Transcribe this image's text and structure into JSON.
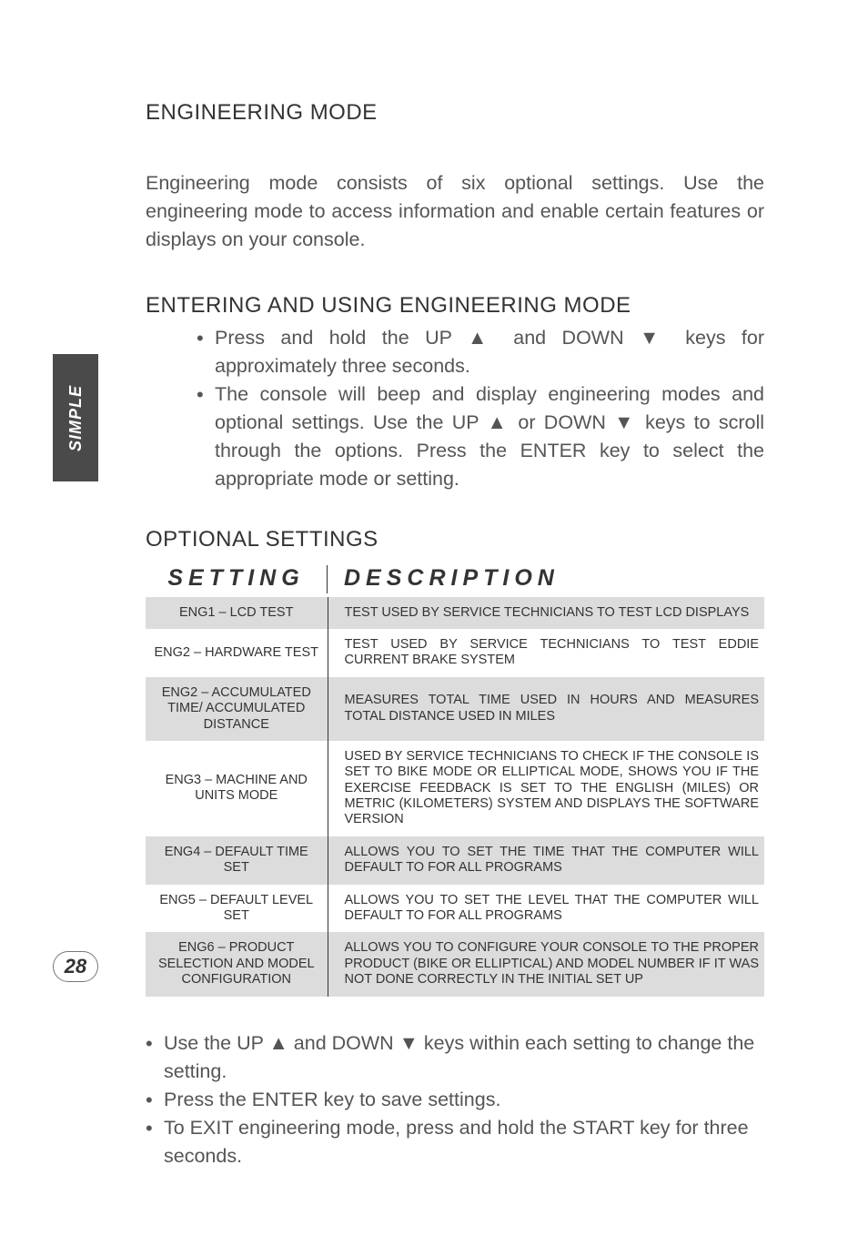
{
  "side_tab": "SIMPLE",
  "page_number": "28",
  "heading_engineering_mode": "ENGINEERING MODE",
  "para_engineering_mode": "Engineering mode consists of six optional settings. Use the engineering mode to access information and enable certain features or displays on your console.",
  "heading_entering": "ENTERING AND USING ENGINEERING MODE",
  "bullets_entering": [
    "Press and hold the UP ▲ and DOWN ▼ keys for approximately three seconds.",
    "The console will beep and display engineering modes and optional settings. Use the UP ▲ or DOWN ▼ keys to scroll through the options. Press the ENTER key to select the appropriate mode or setting."
  ],
  "heading_optional": "OPTIONAL SETTINGS",
  "table_header": {
    "setting": "SETTING",
    "description": "DESCRIPTION"
  },
  "rows": [
    {
      "setting": "ENG1 – LCD TEST",
      "desc": "TEST USED BY SERVICE TECHNICIANS TO TEST LCD DISPLAYS"
    },
    {
      "setting": "ENG2 – HARDWARE TEST",
      "desc": "TEST USED BY SERVICE TECHNICIANS TO TEST EDDIE CURRENT BRAKE SYSTEM"
    },
    {
      "setting": "ENG2 – ACCUMULATED TIME/ ACCUMULATED DISTANCE",
      "desc": "MEASURES TOTAL TIME USED IN HOURS AND MEASURES TOTAL DISTANCE USED IN MILES"
    },
    {
      "setting": "ENG3 – MACHINE AND UNITS MODE",
      "desc": "USED BY SERVICE TECHNICIANS TO CHECK IF THE CONSOLE IS SET TO BIKE MODE OR ELLIPTICAL MODE, SHOWS YOU IF THE EXERCISE FEEDBACK IS SET TO THE ENGLISH (MILES) OR METRIC (KILOMETERS) SYSTEM AND DISPLAYS THE SOFTWARE VERSION"
    },
    {
      "setting": "ENG4 – DEFAULT TIME SET",
      "desc": "ALLOWS YOU TO SET THE TIME THAT THE COMPUTER WILL DEFAULT TO FOR ALL PROGRAMS"
    },
    {
      "setting": "ENG5 – DEFAULT LEVEL SET",
      "desc": "ALLOWS YOU TO SET THE LEVEL THAT THE COMPUTER WILL DEFAULT TO FOR ALL PROGRAMS"
    },
    {
      "setting": "ENG6 – PRODUCT SELECTION AND MODEL CONFIGURATION",
      "desc": "ALLOWS YOU TO CONFIGURE YOUR CONSOLE TO THE PROPER PRODUCT (BIKE OR ELLIPTICAL) AND MODEL NUMBER IF IT WAS NOT DONE CORRECTLY IN THE INITIAL SET UP"
    }
  ],
  "bullets_after": [
    "Use the UP ▲ and DOWN ▼ keys within each setting to change the setting.",
    "Press the ENTER key to save settings.",
    "To EXIT engineering mode, press and hold the START key for three seconds."
  ]
}
